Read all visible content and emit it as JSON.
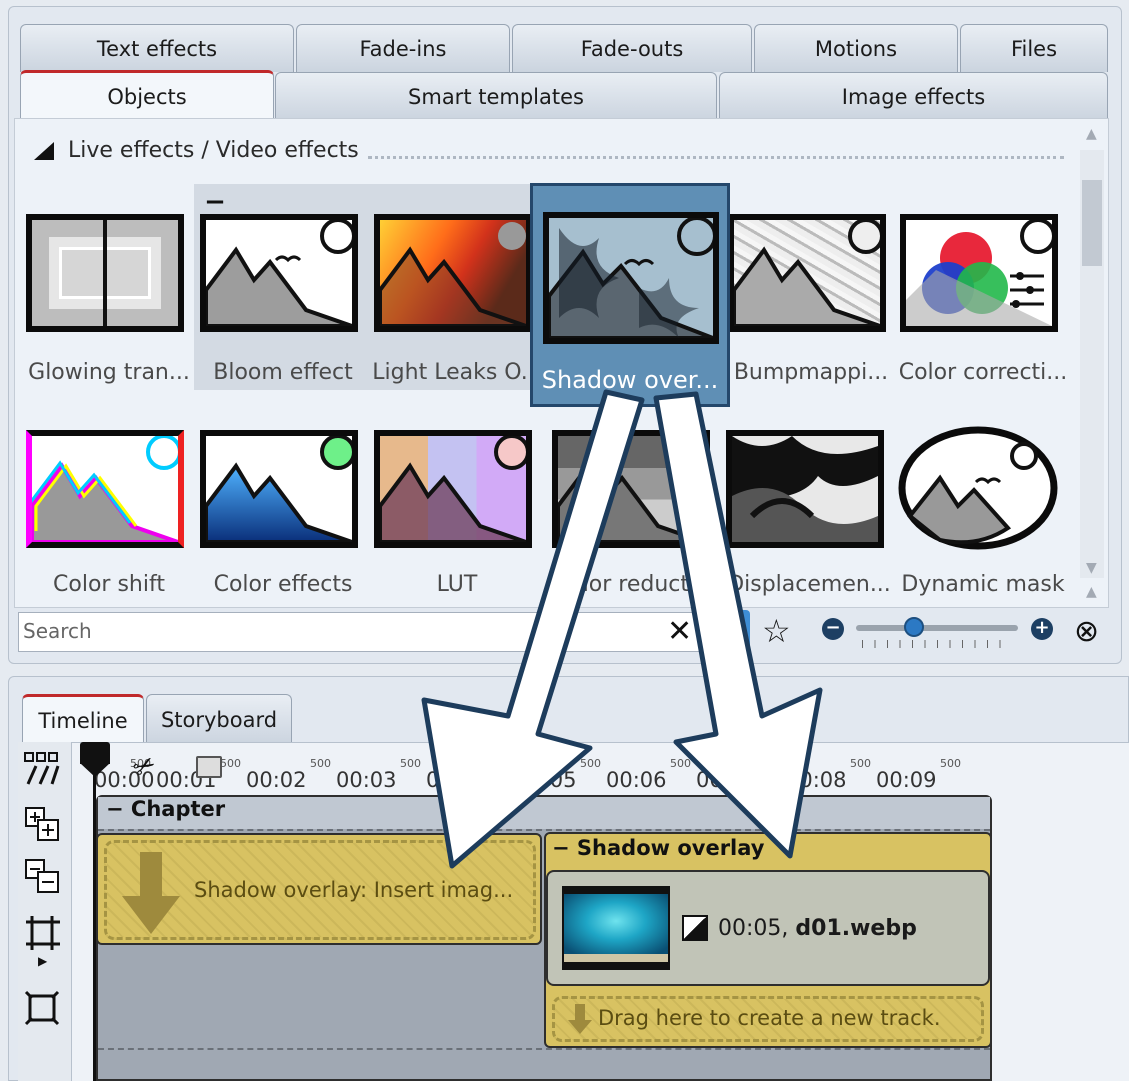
{
  "effect_tabs": {
    "row1": [
      "Text effects",
      "Fade-ins",
      "Fade-outs",
      "Motions",
      "Files"
    ],
    "row2": [
      "Objects",
      "Smart templates",
      "Image effects"
    ]
  },
  "section_title": "Live effects / Video effects",
  "hover_minus": "−",
  "effects": [
    {
      "label": "Glowing tran...",
      "icon": "glow-frame-icon"
    },
    {
      "label": "Bloom effect",
      "icon": "landscape-icon"
    },
    {
      "label": "Light Leaks O...",
      "icon": "light-leak-icon"
    },
    {
      "label": "Shadow over...",
      "icon": "shadow-leaf-icon",
      "selected": true
    },
    {
      "label": "Bumpmappi...",
      "icon": "bumpmap-icon"
    },
    {
      "label": "Color correcti...",
      "icon": "rgb-circles-icon"
    },
    {
      "label": "Color shift",
      "icon": "color-shift-icon"
    },
    {
      "label": "Color effects",
      "icon": "color-effects-icon"
    },
    {
      "label": "LUT",
      "icon": "lut-icon"
    },
    {
      "label": "Color reducti...",
      "icon": "color-reduction-icon"
    },
    {
      "label": "Displacemen...",
      "icon": "displacement-icon"
    },
    {
      "label": "Dynamic mask",
      "icon": "dynamic-mask-icon"
    }
  ],
  "search": {
    "placeholder": "Search",
    "value": ""
  },
  "toolbar": {
    "star_icon": "☆",
    "zoom_minus": "−",
    "zoom_plus": "+",
    "clear_icon": "✕",
    "fit_icon": "⊗"
  },
  "zoom_level_fraction": 0.36,
  "timeline_tabs": [
    "Timeline",
    "Storyboard"
  ],
  "ruler": {
    "labels": [
      "00:00",
      "00:01",
      "00:02",
      "00:03",
      "00:04",
      "00:05",
      "00:06",
      "00:07",
      "00:08",
      "00:09"
    ],
    "half_marks": [
      "500",
      "500",
      "500",
      "500",
      "500",
      "500",
      "500",
      "500",
      "500",
      "500"
    ]
  },
  "tools_icons": [
    "split-tracks-icon",
    "add-track-icon",
    "remove-track-icon",
    "crop-frame-icon",
    "fit-frame-icon"
  ],
  "chapter": {
    "minus": "−",
    "title": "Chapter"
  },
  "insert_placeholder": "Shadow overlay: Insert imag...",
  "overlay": {
    "minus": "−",
    "title": "Shadow overlay",
    "clip_text": "00:05, d01.webp",
    "clip_prefix": "00:05, ",
    "clip_file": "d01.webp",
    "ab_icon": "A/B"
  },
  "drag_zone": "Drag here to create a new track.",
  "colors": {
    "accent_red": "#c0292b",
    "selected_blue": "#5f8fb5",
    "track_gold": "#d8c262",
    "arrow_border": "#1d3c5c"
  }
}
